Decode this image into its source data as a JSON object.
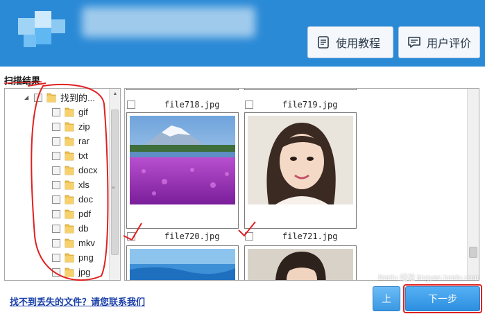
{
  "header": {
    "buttons": [
      {
        "label": "使用教程",
        "icon": "document-icon"
      },
      {
        "label": "用户评价",
        "icon": "comment-icon"
      }
    ]
  },
  "scan_results_title": "扫描结果",
  "tree": {
    "root_label": "找到的...",
    "items": [
      "gif",
      "zip",
      "rar",
      "txt",
      "docx",
      "xls",
      "doc",
      "pdf",
      "db",
      "mkv",
      "png",
      "jpg"
    ]
  },
  "thumbnails": [
    {
      "filename": "file718.jpg"
    },
    {
      "filename": "file719.jpg"
    },
    {
      "filename": "file720.jpg"
    },
    {
      "filename": "file721.jpg"
    }
  ],
  "footer": {
    "help_link": "找不到丢失的文件？请您联系我们",
    "prev_label": "上",
    "next_label": "下一步"
  },
  "watermark": "Baidu 经验 jingyan.baidu.com",
  "colors": {
    "header_bg": "#2b8ad6",
    "accent_red": "#e02020",
    "link": "#1a3fa8"
  }
}
